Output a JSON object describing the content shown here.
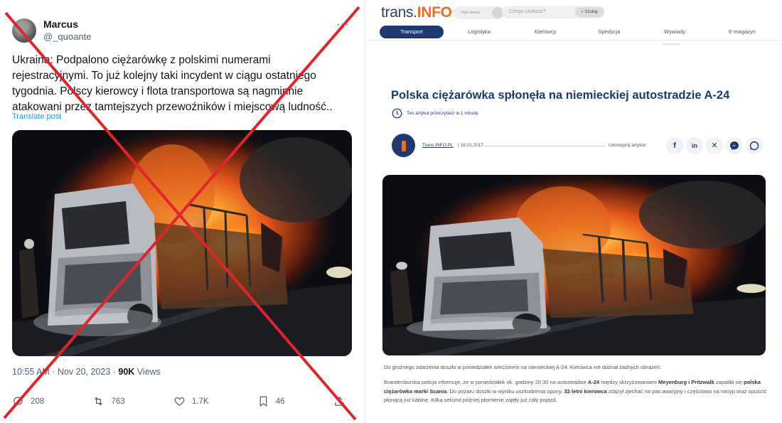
{
  "tweet": {
    "name": "Marcus",
    "handle": "@_quoante",
    "more": "···",
    "text": "Ukraina: Podpalono ciężarówkę z polskimi numerami rejestracyjnymi. To już kolejny taki incydent w ciągu ostatniego tygodnia. Polscy kierowcy i flota transportowa są nagminnie atakowani przez tamtejszych przewoźników i miejscową ludność..",
    "translate": "Translate post",
    "time_date": "10:55 AM · Nov 20, 2023 · ",
    "views_count": "90K",
    "views_label": "Views",
    "replies": "208",
    "reposts": "763",
    "likes": "1.7K",
    "bookmarks": "46"
  },
  "site": {
    "logo_main": "trans.",
    "logo_accent": "INFO",
    "small_pill": "Tryb ciemny",
    "search_placeholder": "Czego szukasz?",
    "search_button": "Szukaj",
    "nav": [
      "Transport",
      "Logistyka",
      "Kierowcy",
      "Spedycja",
      "Wywiady",
      "E-magazyn"
    ],
    "active_nav": "Transport"
  },
  "article": {
    "title": "Polska ciężarówka spłonęła na niemieckiej autostradzie A-24",
    "read_time": "Ten artykuł przeczytasz w 1 minutę",
    "author": "Trans.INFO.PL",
    "date": "| 18.01.2017",
    "share_label": "Udostępnij artykuł",
    "lead": "Do groźnego zdarzenia doszło w poniedziałek wieczorem na niemieckiej A-24. Kierowca nie doznał żadnych obrażeń.",
    "body_1": "Brandenburska policja informuje, że w poniedziałek ok. godziny 20:30 na autostradzie ",
    "body_a24": "A-24",
    "body_2": " między skrzyżowaniami ",
    "body_places": "Meyenburg i Pritzwalk",
    "body_3": " zapaliła się ",
    "body_truck": "polska ciężarówka marki Scania",
    "body_4": ". Do pożaru doszło w wyniku uszkodzenia opony. ",
    "body_driver": "32-letni kierowca",
    "body_5": " zdążył zjechać na pas awaryjny i częściowo na nasyp oraz opuścić płonącą już kabinę. Kilka sekund później płomienie zajęły już cały pojazd."
  },
  "colors": {
    "brand_navy": "#1d3a70",
    "brand_orange": "#f26b1d",
    "twitter_blue": "#1d9bf0",
    "cross_red": "#e0242c"
  },
  "icons": [
    "reply-icon",
    "repost-icon",
    "like-icon",
    "bookmark-icon",
    "share-icon",
    "clock-icon",
    "facebook-icon",
    "linkedin-icon",
    "x-icon",
    "messenger-icon",
    "whatsapp-icon"
  ]
}
